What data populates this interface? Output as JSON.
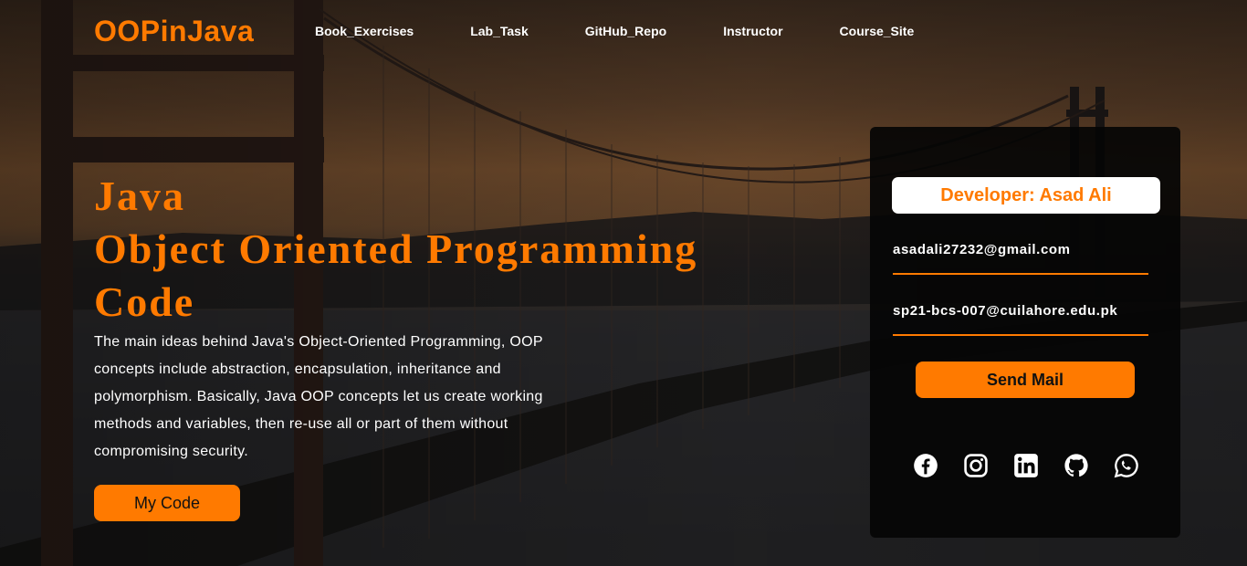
{
  "nav": {
    "logo": "OOPinJava",
    "links": [
      {
        "label": "Book_Exercises"
      },
      {
        "label": "Lab_Task"
      },
      {
        "label": "GitHub_Repo"
      },
      {
        "label": "Instructor"
      },
      {
        "label": "Course_Site"
      }
    ]
  },
  "hero": {
    "title_line1": "Java",
    "title_line2": "Object Oriented Programming",
    "title_line3": "Code",
    "description": "The main ideas behind Java's Object-Oriented Programming, OOP concepts include abstraction, encapsulation, inheritance and polymorphism. Basically, Java OOP concepts let us create working methods and variables, then re-use all or part of them without compromising security.",
    "button_label": "My Code"
  },
  "contact": {
    "developer": "Developer: Asad Ali",
    "email1": "asadali27232@gmail.com",
    "email2": "sp21-bcs-007@cuilahore.edu.pk",
    "send_label": "Send Mail",
    "socials": [
      "facebook-icon",
      "instagram-icon",
      "linkedin-icon",
      "github-icon",
      "whatsapp-icon"
    ]
  },
  "colors": {
    "accent": "#ff7a00",
    "card_bg": "#050505",
    "text": "#ffffff"
  }
}
